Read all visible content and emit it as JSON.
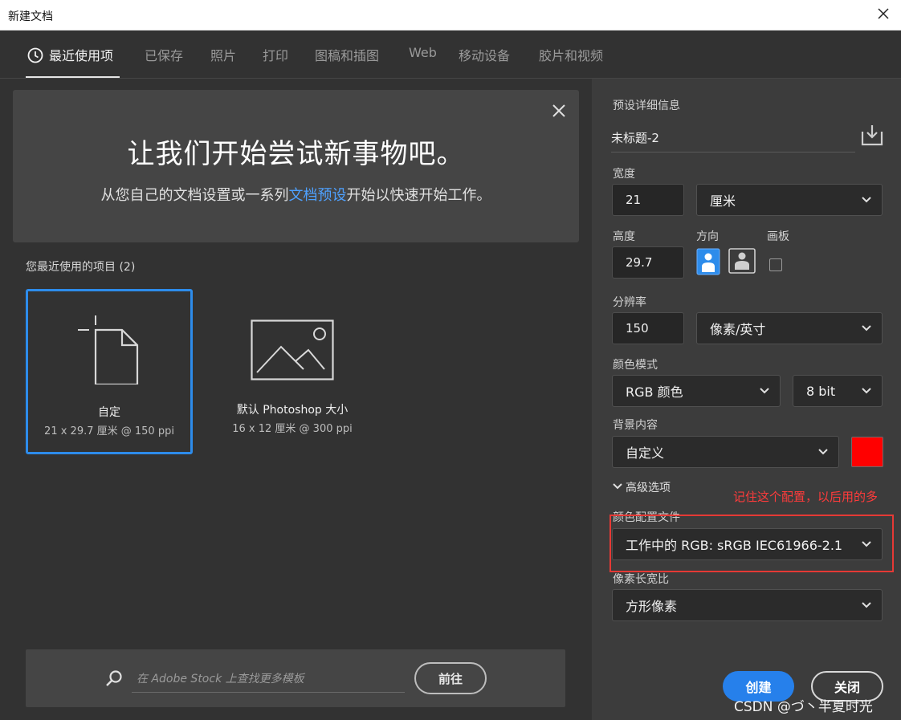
{
  "window": {
    "title": "新建文档"
  },
  "tabs": [
    {
      "label": "最近使用项"
    },
    {
      "label": "已保存"
    },
    {
      "label": "照片"
    },
    {
      "label": "打印"
    },
    {
      "label": "图稿和插图"
    },
    {
      "label": "Web"
    },
    {
      "label": "移动设备"
    },
    {
      "label": "胶片和视频"
    }
  ],
  "banner": {
    "heading": "让我们开始尝试新事物吧。",
    "sub_before": "从您自己的文档设置或一系列",
    "sub_link": "文档预设",
    "sub_after": "开始以快速开始工作。"
  },
  "recent": {
    "title": "您最近使用的项目",
    "count": "(2)",
    "items": [
      {
        "name": "自定",
        "meta": "21 x 29.7 厘米 @ 150 ppi"
      },
      {
        "name": "默认 Photoshop 大小",
        "meta": "16 x 12 厘米 @ 300 ppi"
      }
    ]
  },
  "stock": {
    "placeholder": "在 Adobe Stock 上查找更多模板",
    "go_label": "前往"
  },
  "details": {
    "section_label": "预设详细信息",
    "doc_name": "未标题-2",
    "width_label": "宽度",
    "width_value": "21",
    "width_unit": "厘米",
    "height_label": "高度",
    "height_value": "29.7",
    "orientation_label": "方向",
    "artboard_label": "画板",
    "resolution_label": "分辨率",
    "resolution_value": "150",
    "resolution_unit": "像素/英寸",
    "color_mode_label": "颜色模式",
    "color_mode": "RGB 颜色",
    "bit_depth": "8 bit",
    "background_label": "背景内容",
    "background": "自定义",
    "background_color": "#ff0000",
    "advanced_label": "高级选项",
    "profile_label": "颜色配置文件",
    "profile": "工作中的 RGB: sRGB IEC61966-2.1",
    "pixel_aspect_label": "像素长宽比",
    "pixel_aspect": "方形像素"
  },
  "annotation": {
    "text": "记住这个配置，以后用的多"
  },
  "actions": {
    "create": "创建",
    "close": "关闭"
  },
  "watermark": "CSDN @づ丶半夏时光",
  "colors": {
    "accent": "#2680eb",
    "selected_border": "#2d8ceb",
    "annotation": "#e53935"
  }
}
